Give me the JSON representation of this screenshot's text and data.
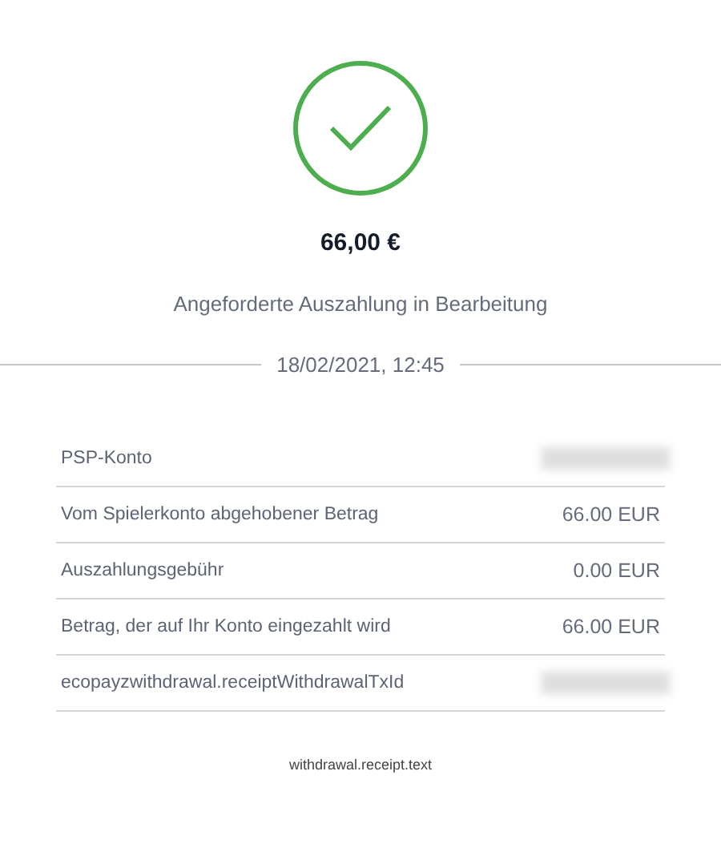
{
  "status_icon": {
    "kind": "success"
  },
  "amount": "66,00 €",
  "status": "Angeforderte Auszahlung in Bearbeitung",
  "date": "18/02/2021, 12:45",
  "rows": [
    {
      "label": "PSP-Konto",
      "kind": "redacted"
    },
    {
      "label": "Vom Spielerkonto abgehobener Betrag",
      "kind": "value",
      "value": "66.00 EUR"
    },
    {
      "label": "Auszahlungsgebühr",
      "kind": "value",
      "value": "0.00 EUR"
    },
    {
      "label": "Betrag, der auf Ihr Konto eingezahlt wird",
      "kind": "value",
      "value": "66.00 EUR"
    },
    {
      "label": "ecopayzwithdrawal.receiptWithdrawalTxId",
      "kind": "redacted"
    }
  ],
  "footer": "withdrawal.receipt.text"
}
